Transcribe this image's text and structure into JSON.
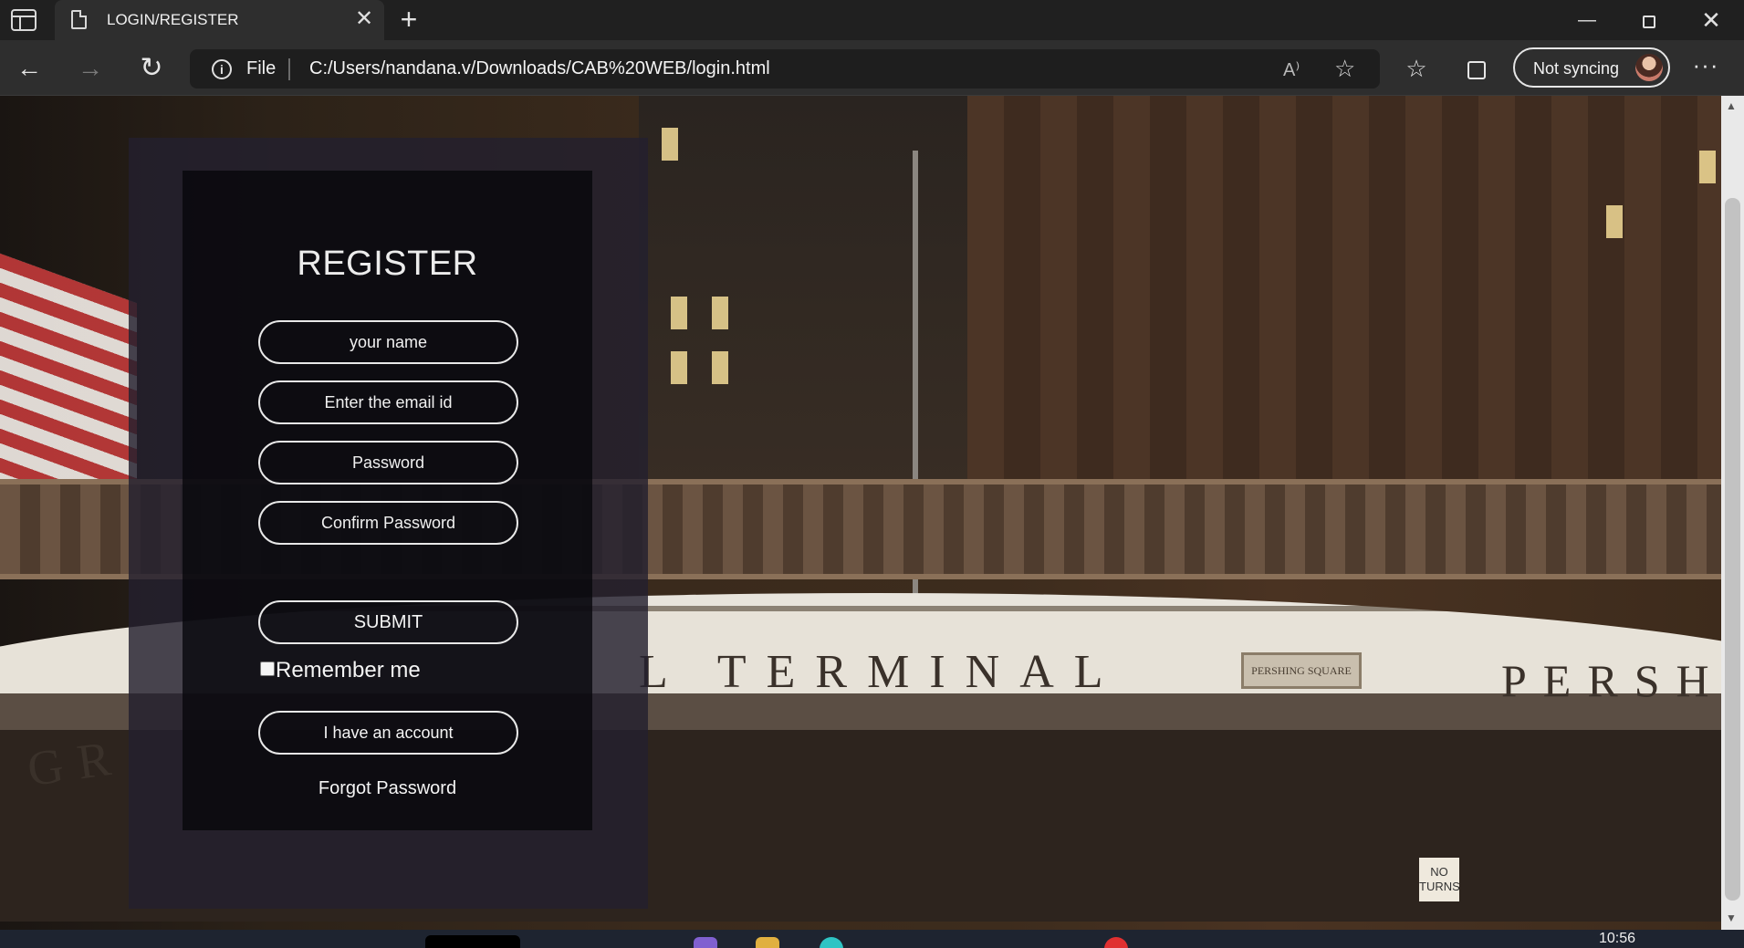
{
  "browser": {
    "tab_title": "LOGIN/REGISTER",
    "tab_close": "✕",
    "new_tab": "+",
    "address_prefix": "File",
    "url": "C:/Users/nandana.v/Downloads/CAB%20WEB/login.html",
    "read_aloud": "A⁾",
    "profile_label": "Not syncing",
    "more": "···"
  },
  "background": {
    "terminal_text": "L TERMINAL",
    "persh_text": "PERSH",
    "gr_text": "GR",
    "plaque": "PERSHING SQUARE",
    "no_turns": "NO TURNS"
  },
  "form": {
    "title": "REGISTER",
    "name_placeholder": "your name",
    "email_placeholder": "Enter the email id",
    "password_placeholder": "Password",
    "confirm_placeholder": "Confirm Password",
    "submit_label": "SUBMIT",
    "remember_label": "Remember me",
    "remember_checked": false,
    "account_label": "I have an account",
    "forgot_label": "Forgot Password"
  },
  "taskbar": {
    "clock": "10:56"
  },
  "icons": {
    "back": "back-arrow-icon",
    "forward": "forward-arrow-icon",
    "reload": "reload-icon",
    "info": "info-icon",
    "favorites": "favorites-icon",
    "collections": "collections-icon"
  },
  "colors": {
    "chrome_bg": "#202020",
    "toolbar_bg": "#2e2e2e",
    "form_outer": "#23202e",
    "form_inner": "#06060a",
    "traffic_red": "#ff2828"
  }
}
